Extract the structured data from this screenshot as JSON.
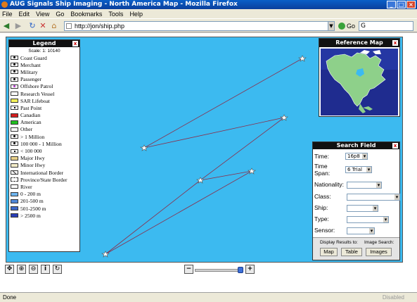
{
  "window": {
    "title": "AUG Signals Ship Imaging - North America Map - Mozilla Firefox"
  },
  "menu": [
    "File",
    "Edit",
    "View",
    "Go",
    "Bookmarks",
    "Tools",
    "Help"
  ],
  "toolbar": {
    "url": "http://jon/ship.php",
    "go_label": "Go",
    "search_value": "G"
  },
  "legend": {
    "title": "Legend",
    "scale_text": "Scale:  1: 10140",
    "items": [
      {
        "label": "Coast Guard",
        "kind": "boat",
        "color": "#ffffff"
      },
      {
        "label": "Merchant",
        "kind": "boat",
        "color": "#ffffff"
      },
      {
        "label": "Military",
        "kind": "boat",
        "color": "#ffffff"
      },
      {
        "label": "Passenger",
        "kind": "boat",
        "color": "#ffffff"
      },
      {
        "label": "Offshore Patrol",
        "kind": "pen",
        "color": "#ffffff"
      },
      {
        "label": "Research Vessel",
        "kind": "plain",
        "color": "#ffffff"
      },
      {
        "label": "SAR Lifeboat",
        "kind": "plain",
        "color": "#f2ef58"
      },
      {
        "label": "Past Point",
        "kind": "dot",
        "color": "#ffffff"
      },
      {
        "label": "Canadian",
        "kind": "plain",
        "color": "#d42020"
      },
      {
        "label": "American",
        "kind": "plain",
        "color": "#22c122"
      },
      {
        "label": "Other",
        "kind": "plain",
        "color": "#ffffff"
      },
      {
        "label": "> 1 Million",
        "kind": "boat",
        "color": "#ffffff"
      },
      {
        "label": "100 000 - 1 Million",
        "kind": "boat",
        "color": "#ffffff"
      },
      {
        "label": "< 100 000",
        "kind": "dot",
        "color": "#ffffff"
      },
      {
        "label": "Major Hwy",
        "kind": "plain",
        "color": "#e8d08a"
      },
      {
        "label": "Minor Hwy",
        "kind": "plain",
        "color": "#f3ecc8"
      },
      {
        "label": "International Border",
        "kind": "diag",
        "color": "#ffffff"
      },
      {
        "label": "Province/State Border",
        "kind": "dash",
        "color": "#ffffff"
      },
      {
        "label": "River",
        "kind": "plain",
        "color": "#ffffff"
      },
      {
        "label": "0 - 200 m",
        "kind": "plain",
        "color": "#6fb6f0"
      },
      {
        "label": "201-500 m",
        "kind": "plain",
        "color": "#4f87d8"
      },
      {
        "label": "501-2500 m",
        "kind": "plain",
        "color": "#3d68c8"
      },
      {
        "label": "> 2500 m",
        "kind": "plain",
        "color": "#2a3fb8"
      }
    ]
  },
  "reference_map": {
    "title": "Reference Map"
  },
  "search": {
    "title": "Search Field",
    "time_label": "Time:",
    "time_value": "16p8",
    "timespan_label": "Time Span:",
    "timespan_value": "6 Trial",
    "nationality_label": "Nationality:",
    "class_label": "Class:",
    "ship_label": "Ship:",
    "type_label": "Type:",
    "sensor_label": "Sensor:",
    "display_label": "Display Results to:",
    "image_search_label": "Image Search:",
    "map_button": "Map",
    "table_button": "Table",
    "images_button": "Images"
  },
  "status": {
    "left": "Done",
    "right": "Disabled"
  },
  "colors": {
    "ocean": "#3cbaf0",
    "track_line": "#8b2d4a",
    "title_bar": "#0a5fc8"
  }
}
